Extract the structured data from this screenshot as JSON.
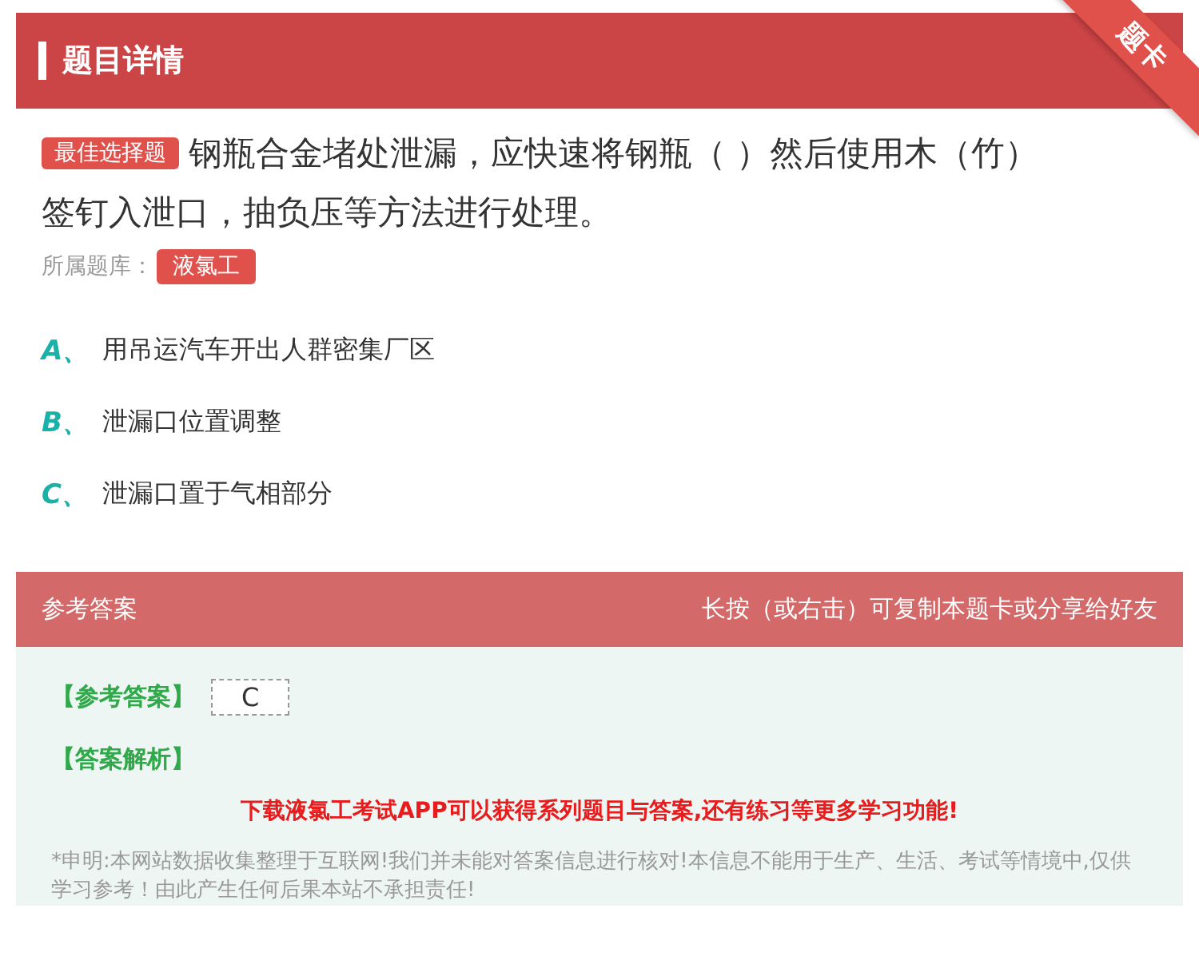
{
  "header": {
    "title": "题目详情",
    "ribbon": "题卡"
  },
  "question": {
    "type_badge": "最佳选择题",
    "text": "钢瓶合金堵处泄漏，应快速将钢瓶（ ）然后使用木（竹）签钉入泄口，抽负压等方法进行处理。",
    "bank_label": "所属题库：",
    "bank": "液氯工"
  },
  "options": [
    {
      "letter": "A、",
      "text": "用吊运汽车开出人群密集厂区"
    },
    {
      "letter": "B、",
      "text": "泄漏口位置调整"
    },
    {
      "letter": "C、",
      "text": "泄漏口置于气相部分"
    }
  ],
  "answer_bar": {
    "title": "参考答案",
    "hint": "长按（或右击）可复制本题卡或分享给好友"
  },
  "answer": {
    "label": "【参考答案】",
    "value": "C",
    "analysis_label": "【答案解析】",
    "promo": "下载液氯工考试APP可以获得系列题目与答案,还有练习等更多学习功能!",
    "disclaimer": "*申明:本网站数据收集整理于互联网!我们并未能对答案信息进行核对!本信息不能用于生产、生活、考试等情境中,仅供学习参考！由此产生任何后果本站不承担责任!"
  }
}
